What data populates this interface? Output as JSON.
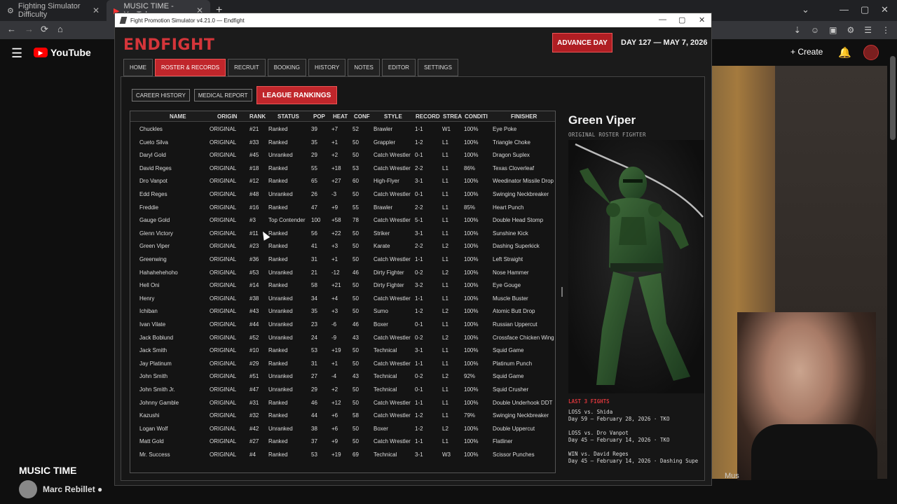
{
  "browser": {
    "tabs": [
      {
        "label": "Fighting Simulator Difficulty",
        "close": "✕"
      },
      {
        "label": "MUSIC TIME - YouTube",
        "close": "✕"
      }
    ],
    "new_tab": "+",
    "win_controls": [
      "—",
      "▢",
      "✕"
    ],
    "nav": {
      "back": "←",
      "forward": "→",
      "reload": "⟳",
      "home": "⌂"
    },
    "extensions": [
      "⇣",
      "☺",
      "▣",
      "⚙",
      "☰",
      "⋮"
    ]
  },
  "youtube": {
    "menu_icon": "☰",
    "logo_text": "YouTube",
    "create_label": "+ Create",
    "bell_icon": "🔔",
    "video_title": "MUSIC TIME",
    "channel_name": "Marc Rebillet ●",
    "chip_label": "Mus"
  },
  "window": {
    "title": "Fight Promotion Simulator v4.21.0 — Endfight",
    "controls": [
      "—",
      "▢",
      "✕"
    ]
  },
  "app": {
    "logo": "ENDFIGHT",
    "advance_label": "ADVANCE DAY",
    "day_label": "DAY 127 — MAY 7, 2026",
    "nav_tabs": [
      "HOME",
      "ROSTER & RECORDS",
      "RECRUIT",
      "BOOKING",
      "HISTORY",
      "NOTES",
      "EDITOR",
      "SETTINGS"
    ],
    "active_tab": "ROSTER & RECORDS",
    "subnav": [
      "CAREER HISTORY",
      "MEDICAL REPORT",
      "LEAGUE RANKINGS"
    ]
  },
  "table": {
    "columns": [
      "NAME",
      "ORIGIN",
      "RANK",
      "STATUS",
      "POP",
      "HEAT",
      "CONF",
      "STYLE",
      "RECORD",
      "STREA",
      "CONDITI",
      "FINISHER"
    ],
    "rows": [
      [
        "Chuckles",
        "ORIGINAL",
        "#21",
        "Ranked",
        "39",
        "+7",
        "52",
        "Brawler",
        "1-1",
        "W1",
        "100%",
        "Eye Poke"
      ],
      [
        "Cueto Silva",
        "ORIGINAL",
        "#33",
        "Ranked",
        "35",
        "+1",
        "50",
        "Grappler",
        "1-2",
        "L1",
        "100%",
        "Triangle Choke"
      ],
      [
        "Daryl Gold",
        "ORIGINAL",
        "#45",
        "Unranked",
        "29",
        "+2",
        "50",
        "Catch Wrestler",
        "0-1",
        "L1",
        "100%",
        "Dragon Suplex"
      ],
      [
        "David Reges",
        "ORIGINAL",
        "#18",
        "Ranked",
        "55",
        "+18",
        "53",
        "Catch Wrestler",
        "2-2",
        "L1",
        "86%",
        "Texas Cloverleaf"
      ],
      [
        "Dro Vanpot",
        "ORIGINAL",
        "#12",
        "Ranked",
        "65",
        "+27",
        "60",
        "High-Flyer",
        "3-1",
        "L1",
        "100%",
        "Weedinator Missile Drop"
      ],
      [
        "Edd Reges",
        "ORIGINAL",
        "#48",
        "Unranked",
        "26",
        "-3",
        "50",
        "Catch Wrestler",
        "0-1",
        "L1",
        "100%",
        "Swinging Neckbreaker"
      ],
      [
        "Freddie",
        "ORIGINAL",
        "#16",
        "Ranked",
        "47",
        "+9",
        "55",
        "Brawler",
        "2-2",
        "L1",
        "85%",
        "Heart Punch"
      ],
      [
        "Gauge Gold",
        "ORIGINAL",
        "#3",
        "Top Contender",
        "100",
        "+58",
        "78",
        "Catch Wrestler",
        "5-1",
        "L1",
        "100%",
        "Double Head Stomp"
      ],
      [
        "Glenn Victory",
        "ORIGINAL",
        "#11",
        "Ranked",
        "56",
        "+22",
        "50",
        "Striker",
        "3-1",
        "L1",
        "100%",
        "Sunshine Kick"
      ],
      [
        "Green Viper",
        "ORIGINAL",
        "#23",
        "Ranked",
        "41",
        "+3",
        "50",
        "Karate",
        "2-2",
        "L2",
        "100%",
        "Dashing Superkick"
      ],
      [
        "Greenwing",
        "ORIGINAL",
        "#36",
        "Ranked",
        "31",
        "+1",
        "50",
        "Catch Wrestler",
        "1-1",
        "L1",
        "100%",
        "Left Straight"
      ],
      [
        "Hahahehehoho",
        "ORIGINAL",
        "#53",
        "Unranked",
        "21",
        "-12",
        "46",
        "Dirty Fighter",
        "0-2",
        "L2",
        "100%",
        "Nose Hammer"
      ],
      [
        "Hell Oni",
        "ORIGINAL",
        "#14",
        "Ranked",
        "58",
        "+21",
        "50",
        "Dirty Fighter",
        "3-2",
        "L1",
        "100%",
        "Eye Gouge"
      ],
      [
        "Henry",
        "ORIGINAL",
        "#38",
        "Unranked",
        "34",
        "+4",
        "50",
        "Catch Wrestler",
        "1-1",
        "L1",
        "100%",
        "Muscle Buster"
      ],
      [
        "Ichiban",
        "ORIGINAL",
        "#43",
        "Unranked",
        "35",
        "+3",
        "50",
        "Sumo",
        "1-2",
        "L2",
        "100%",
        "Atomic Butt Drop"
      ],
      [
        "Ivan Vilate",
        "ORIGINAL",
        "#44",
        "Unranked",
        "23",
        "-6",
        "46",
        "Boxer",
        "0-1",
        "L1",
        "100%",
        "Russian Uppercut"
      ],
      [
        "Jack Boblund",
        "ORIGINAL",
        "#52",
        "Unranked",
        "24",
        "-9",
        "43",
        "Catch Wrestler",
        "0-2",
        "L2",
        "100%",
        "Crossface Chicken Wing"
      ],
      [
        "Jack Smith",
        "ORIGINAL",
        "#10",
        "Ranked",
        "53",
        "+19",
        "50",
        "Technical",
        "3-1",
        "L1",
        "100%",
        "Squid Game"
      ],
      [
        "Jay Platinum",
        "ORIGINAL",
        "#29",
        "Ranked",
        "31",
        "+1",
        "50",
        "Catch Wrestler",
        "1-1",
        "L1",
        "100%",
        "Platinum Punch"
      ],
      [
        "John Smith",
        "ORIGINAL",
        "#51",
        "Unranked",
        "27",
        "-4",
        "43",
        "Technical",
        "0-2",
        "L2",
        "92%",
        "Squid Game"
      ],
      [
        "John Smith Jr.",
        "ORIGINAL",
        "#47",
        "Unranked",
        "29",
        "+2",
        "50",
        "Technical",
        "0-1",
        "L1",
        "100%",
        "Squid Crusher"
      ],
      [
        "Johnny Gamble",
        "ORIGINAL",
        "#31",
        "Ranked",
        "46",
        "+12",
        "50",
        "Catch Wrestler",
        "1-1",
        "L1",
        "100%",
        "Double Underhook DDT"
      ],
      [
        "Kazushi",
        "ORIGINAL",
        "#32",
        "Ranked",
        "44",
        "+6",
        "58",
        "Catch Wrestler",
        "1-2",
        "L1",
        "79%",
        "Swinging Neckbreaker"
      ],
      [
        "Logan Wolf",
        "ORIGINAL",
        "#42",
        "Unranked",
        "38",
        "+6",
        "50",
        "Boxer",
        "1-2",
        "L2",
        "100%",
        "Double Uppercut"
      ],
      [
        "Matt Gold",
        "ORIGINAL",
        "#27",
        "Ranked",
        "37",
        "+9",
        "50",
        "Catch Wrestler",
        "1-1",
        "L1",
        "100%",
        "Flatliner"
      ],
      [
        "Mr. Success",
        "ORIGINAL",
        "#4",
        "Ranked",
        "53",
        "+19",
        "69",
        "Technical",
        "3-1",
        "W3",
        "100%",
        "Scissor Punches"
      ]
    ]
  },
  "detail": {
    "name": "Green Viper",
    "subtitle": "ORIGINAL ROSTER FIGHTER",
    "last_fights_header": "LAST 3 FIGHTS",
    "fights": [
      {
        "line1": "LOSS vs. Shida",
        "line2": "Day 59 — February 28, 2026 · TKO"
      },
      {
        "line1": "LOSS vs. Dro Vanpot",
        "line2": "Day 45 — February 14, 2026 · TKO"
      },
      {
        "line1": "WIN vs. David Reges",
        "line2": "Day 45 — February 14, 2026 · Dashing Supe"
      }
    ]
  },
  "colors": {
    "accent": "#c0262b",
    "logo": "#d4353a",
    "background": "#1b1b1b"
  }
}
